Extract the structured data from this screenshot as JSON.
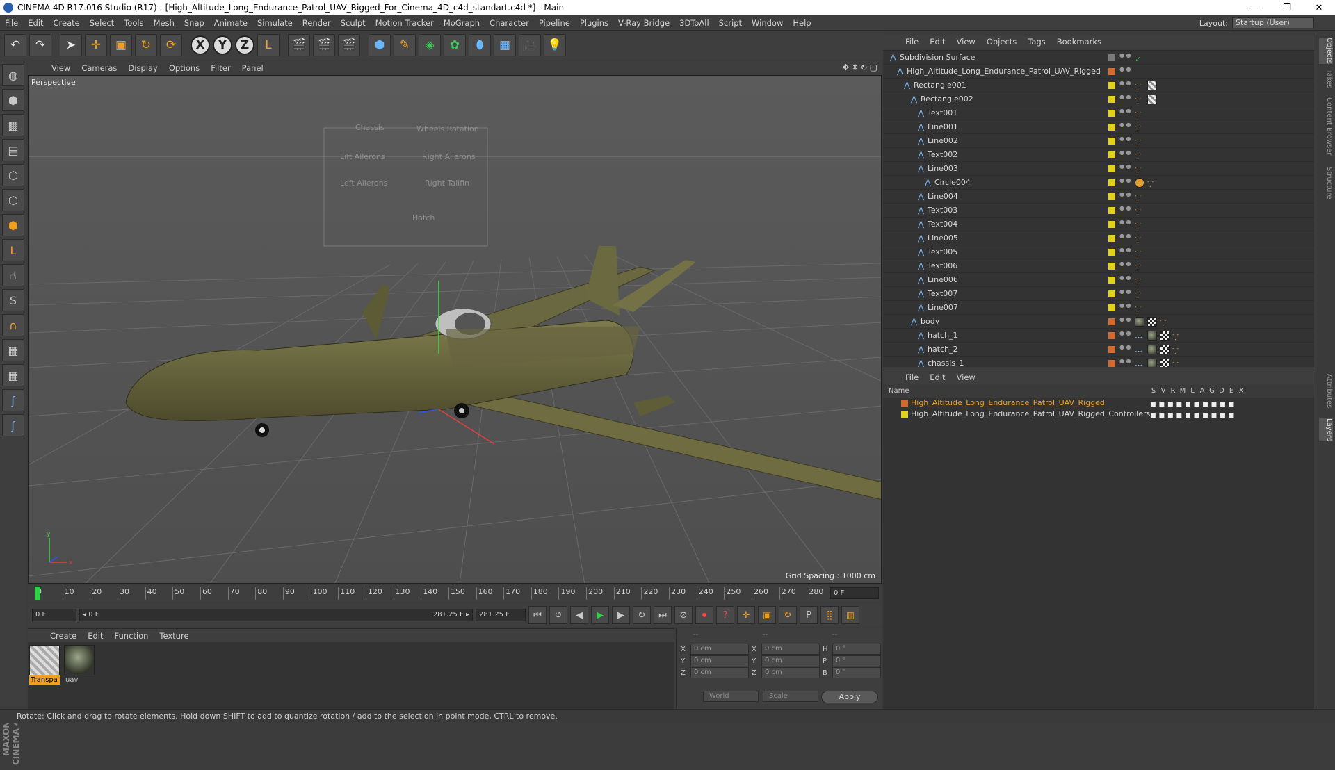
{
  "window": {
    "title": "CINEMA 4D R17.016 Studio (R17) - [High_Altitude_Long_Endurance_Patrol_UAV_Rigged_For_Cinema_4D_c4d_standart.c4d *] - Main",
    "min": "—",
    "max": "❐",
    "close": "✕"
  },
  "menu": [
    "File",
    "Edit",
    "Create",
    "Select",
    "Tools",
    "Mesh",
    "Snap",
    "Animate",
    "Simulate",
    "Render",
    "Sculpt",
    "Motion Tracker",
    "MoGraph",
    "Character",
    "Pipeline",
    "Plugins",
    "V-Ray Bridge",
    "3DToAll",
    "Script",
    "Window",
    "Help"
  ],
  "layout": {
    "label": "Layout:",
    "value": "Startup (User)"
  },
  "toolbar": {
    "undo": "↶",
    "redo": "↷",
    "select": "➤",
    "move": "✛",
    "scale": "▣",
    "rotate": "↻",
    "recent": "⟳",
    "x": "X",
    "y": "Y",
    "z": "Z",
    "world": "L",
    "render_view": "🎬",
    "render": "🎬",
    "render_settings": "🎬",
    "cube": "⬢",
    "pen": "✎",
    "subdiv": "◈",
    "cloner": "✿",
    "deformer": "⬮",
    "floor": "▦",
    "camera": "🎥",
    "light": "💡"
  },
  "viewport": {
    "menu": [
      "View",
      "Cameras",
      "Display",
      "Options",
      "Filter",
      "Panel"
    ],
    "label": "Perspective",
    "grid_spacing": "Grid Spacing : 1000 cm",
    "hud": [
      "Chassis",
      "Wheels Rotation",
      "Lift Ailerons",
      "Right Ailerons",
      "Left Ailerons",
      "Right Tailfin",
      "Hatch"
    ],
    "axis_y": "y",
    "axis_x": "x"
  },
  "timeline": {
    "ticks": [
      "0",
      "10",
      "20",
      "30",
      "40",
      "50",
      "60",
      "70",
      "80",
      "90",
      "100",
      "110",
      "120",
      "130",
      "140",
      "150",
      "160",
      "170",
      "180",
      "190",
      "200",
      "210",
      "220",
      "230",
      "240",
      "250",
      "260",
      "270",
      "280"
    ],
    "frame": "0 F"
  },
  "transport": {
    "start": "0 F",
    "range_start": "◂ 0 F",
    "range_end": "281.25 F ▸",
    "end": "281.25 F",
    "first": "⏮",
    "prev_key": "↺",
    "prev": "◀",
    "play": "▶",
    "next": "▶",
    "next_key": "↻",
    "last": "⏭",
    "record_pos": "⊘",
    "record": "⏺",
    "auto": "?",
    "move": "✛",
    "scale": "▣",
    "rotate": "↻",
    "param": "P",
    "pla": "⣿",
    "timeline": "▥"
  },
  "materials": {
    "menu": [
      "Create",
      "Edit",
      "Function",
      "Texture"
    ],
    "items": [
      {
        "name": "Transpa"
      },
      {
        "name": "uav"
      }
    ]
  },
  "coords": {
    "header": [
      "--",
      "--",
      "--"
    ],
    "rows": [
      {
        "a": "X",
        "av": "0 cm",
        "b": "X",
        "bv": "0 cm",
        "c": "H",
        "cv": "0 °"
      },
      {
        "a": "Y",
        "av": "0 cm",
        "b": "Y",
        "bv": "0 cm",
        "c": "P",
        "cv": "0 °"
      },
      {
        "a": "Z",
        "av": "0 cm",
        "b": "Z",
        "bv": "0 cm",
        "c": "B",
        "cv": "0 °"
      }
    ],
    "world": "World",
    "scale": "Scale",
    "apply": "Apply"
  },
  "status": "Rotate: Click and drag to rotate elements. Hold down SHIFT to add to quantize rotation / add to the selection in point mode, CTRL to remove.",
  "objects": {
    "menu": [
      "File",
      "Edit",
      "View",
      "Objects",
      "Tags",
      "Bookmarks"
    ],
    "rows": [
      {
        "name": "Subdivision Surface",
        "depth": 0,
        "color": "#7a7a7a",
        "tags": "check"
      },
      {
        "name": "High_Altitude_Long_Endurance_Patrol_UAV_Rigged",
        "depth": 1,
        "color": "#d06a30",
        "tags": ""
      },
      {
        "name": "Rectangle001",
        "depth": 2,
        "color": "#e0d020",
        "tags": "bone-tex"
      },
      {
        "name": "Rectangle002",
        "depth": 3,
        "color": "#e0d020",
        "tags": "bone-tex"
      },
      {
        "name": "Text001",
        "depth": 4,
        "color": "#e0d020",
        "tags": "bone"
      },
      {
        "name": "Line001",
        "depth": 4,
        "color": "#e0d020",
        "tags": "bone"
      },
      {
        "name": "Line002",
        "depth": 4,
        "color": "#e0d020",
        "tags": "bone"
      },
      {
        "name": "Text002",
        "depth": 4,
        "color": "#e0d020",
        "tags": "bone"
      },
      {
        "name": "Line003",
        "depth": 4,
        "color": "#e0d020",
        "tags": "bone"
      },
      {
        "name": "Circle004",
        "depth": 5,
        "color": "#e0d020",
        "tags": "noentry-bone"
      },
      {
        "name": "Line004",
        "depth": 4,
        "color": "#e0d020",
        "tags": "bone"
      },
      {
        "name": "Text003",
        "depth": 4,
        "color": "#e0d020",
        "tags": "bone"
      },
      {
        "name": "Text004",
        "depth": 4,
        "color": "#e0d020",
        "tags": "bone"
      },
      {
        "name": "Line005",
        "depth": 4,
        "color": "#e0d020",
        "tags": "bone"
      },
      {
        "name": "Text005",
        "depth": 4,
        "color": "#e0d020",
        "tags": "bone"
      },
      {
        "name": "Text006",
        "depth": 4,
        "color": "#e0d020",
        "tags": "bone"
      },
      {
        "name": "Line006",
        "depth": 4,
        "color": "#e0d020",
        "tags": "bone"
      },
      {
        "name": "Text007",
        "depth": 4,
        "color": "#e0d020",
        "tags": "bone"
      },
      {
        "name": "Line007",
        "depth": 4,
        "color": "#e0d020",
        "tags": "bone"
      },
      {
        "name": "body",
        "depth": 3,
        "color": "#d06a30",
        "tags": "mat-chk-bone"
      },
      {
        "name": "hatch_1",
        "depth": 4,
        "color": "#d06a30",
        "tags": "pts-mat-chk-bone"
      },
      {
        "name": "hatch_2",
        "depth": 4,
        "color": "#d06a30",
        "tags": "pts-mat-chk-bone"
      },
      {
        "name": "chassis_1",
        "depth": 4,
        "color": "#d06a30",
        "tags": "pts-mat-chk-bone"
      }
    ]
  },
  "layers": {
    "menu": [
      "File",
      "Edit",
      "View"
    ],
    "header": "Name",
    "cols": [
      "S",
      "V",
      "R",
      "M",
      "L",
      "A",
      "G",
      "D",
      "E",
      "X"
    ],
    "rows": [
      {
        "name": "High_Altitude_Long_Endurance_Patrol_UAV_Rigged",
        "color": "#d06a30",
        "text_color": "#f0a020"
      },
      {
        "name": "High_Altitude_Long_Endurance_Patrol_UAV_Rigged_Controllers",
        "color": "#e0d020",
        "text_color": "#d6d6d6"
      }
    ]
  },
  "sidetabs": [
    "Objects",
    "Takes",
    "Content Browser",
    "Structure",
    "Attributes",
    "Layers"
  ]
}
